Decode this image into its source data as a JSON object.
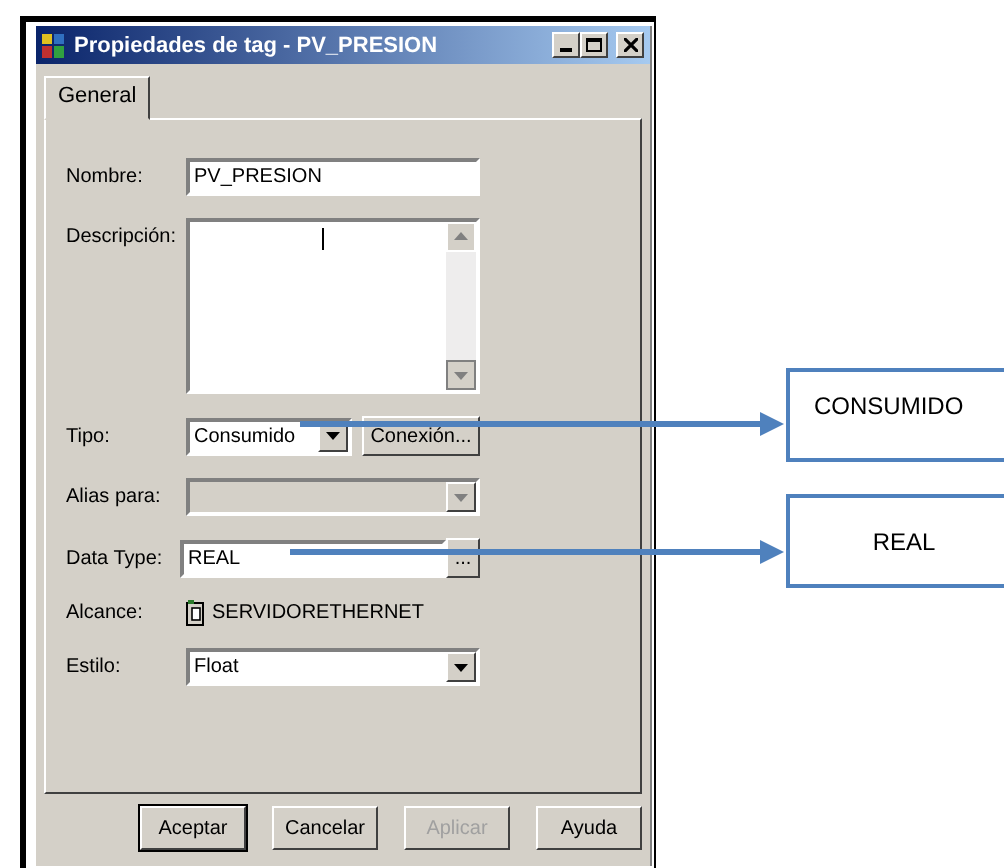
{
  "window": {
    "title": "Propiedades de tag - PV_PRESION"
  },
  "tabs": [
    {
      "label": "General",
      "selected": true
    }
  ],
  "fields": [
    {
      "kind": "text",
      "label": "Nombre:",
      "value": "PV_PRESION"
    },
    {
      "kind": "textarea",
      "label": "Descripción:"
    },
    {
      "kind": "combo",
      "label": "Tipo:",
      "value": "Consumido",
      "disabled": false,
      "button": "Conexión..."
    },
    {
      "kind": "combo",
      "label": "Alias para:",
      "disabled": true
    },
    {
      "kind": "browse",
      "label": "Data Type:",
      "value": "REAL",
      "button": "..."
    },
    {
      "kind": "scope",
      "label": "Alcance:",
      "value": "SERVIDORETHERNET"
    },
    {
      "kind": "combo",
      "label": "Estilo:",
      "value": "Float",
      "disabled": false
    }
  ],
  "buttons": [
    {
      "label": "Aceptar",
      "disabled": false
    },
    {
      "label": "Cancelar",
      "disabled": false
    },
    {
      "label": "Aplicar",
      "disabled": true
    },
    {
      "label": "Ayuda",
      "disabled": false
    }
  ],
  "callouts": [
    {
      "text": "CONSUMIDO"
    },
    {
      "text": "REAL"
    }
  ]
}
